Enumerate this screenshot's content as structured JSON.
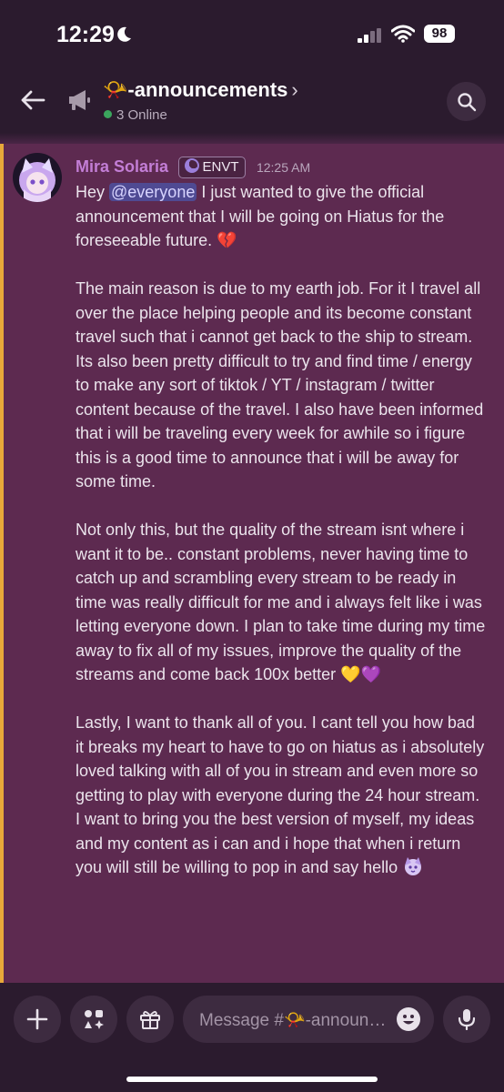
{
  "status_bar": {
    "time": "12:29",
    "battery": "98"
  },
  "header": {
    "channel_name": "📯-announcements",
    "chevron": "›",
    "online": "3 Online"
  },
  "message": {
    "author": "Mira Solaria",
    "tag": "ENVT",
    "timestamp": "12:25 AM",
    "p1_pre": "Hey ",
    "mention": "@everyone",
    "p1_post": " I just wanted to give the official announcement that I will be going on Hiatus for the foreseeable future. 💔",
    "p2": "The main reason is due to my earth job. For it I travel all over the place helping people and its become constant travel such that i cannot get back to the ship to stream. Its also been pretty difficult to try and find time / energy to make any sort of tiktok / YT / instagram / twitter content because of the travel. I also have been informed that i will be traveling every week for awhile so i figure this is a good time to announce that i will be away for some time.",
    "p3": "Not only this, but the quality of the stream isnt where i want it to be.. constant problems, never having time to catch up and scrambling every stream to be ready in time was really difficult for me and i always felt like i was letting everyone down. I plan to take time during my time away to fix all of my issues, improve the quality of the streams and come back 100x better 💛💜",
    "p4": "Lastly, I want to thank all of you. I cant tell you how bad it breaks my heart to have to go on hiatus as i absolutely loved talking with all of you in stream and even more so getting to play with everyone during the 24 hour stream. I want to bring you the best version of myself, my ideas and my content as i can and i hope that when i return you will still be willing to pop in and say hello"
  },
  "composer": {
    "placeholder": "Message #📯-announcements"
  },
  "icons": {
    "back": "back-arrow-icon",
    "channel": "megaphone-icon",
    "search": "search-icon",
    "add": "plus-icon",
    "apps": "apps-icon",
    "gift": "gift-icon",
    "emoji": "emoji-icon",
    "mic": "microphone-icon"
  },
  "colors": {
    "background": "#2b1b2e",
    "message_highlight": "#5d2a50",
    "highlight_bar": "#e8a83a",
    "username": "#c37ed6",
    "mention_bg": "#4f4a93",
    "online": "#3ba55d"
  }
}
